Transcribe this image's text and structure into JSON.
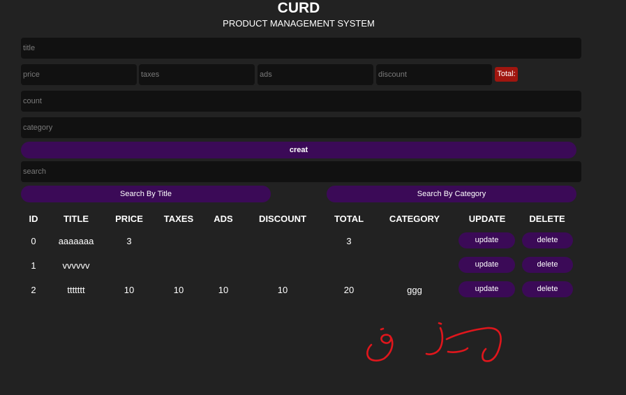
{
  "header": {
    "title": "CURD",
    "subtitle": "PRODUCT MANAGEMENT SYSTEM"
  },
  "form": {
    "title_placeholder": "title",
    "price_placeholder": "price",
    "taxes_placeholder": "taxes",
    "ads_placeholder": "ads",
    "discount_placeholder": "discount",
    "total_label": "Total:",
    "count_placeholder": "count",
    "category_placeholder": "category",
    "create_label": "creat"
  },
  "search": {
    "placeholder": "search",
    "by_title_label": "Search By Title",
    "by_category_label": "Search By Category"
  },
  "table": {
    "headers": [
      "ID",
      "TITLE",
      "PRICE",
      "TAXES",
      "ADS",
      "DISCOUNT",
      "TOTAL",
      "CATEGORY",
      "UPDATE",
      "DELETE"
    ],
    "rows": [
      {
        "id": "0",
        "title": "aaaaaaa",
        "price": "3",
        "taxes": "",
        "ads": "",
        "discount": "",
        "total": "3",
        "category": "",
        "update": "update",
        "delete": "delete"
      },
      {
        "id": "1",
        "title": "vvvvvv",
        "price": "",
        "taxes": "",
        "ads": "",
        "discount": "",
        "total": "",
        "category": "",
        "update": "update",
        "delete": "delete"
      },
      {
        "id": "2",
        "title": "ttttttt",
        "price": "10",
        "taxes": "10",
        "ads": "10",
        "discount": "10",
        "total": "20",
        "category": "ggg",
        "update": "update",
        "delete": "delete"
      }
    ]
  },
  "colors": {
    "background": "#222222",
    "input_background": "#111111",
    "button_purple": "#3b0a57",
    "total_red": "#a0160f",
    "scribble_red": "#e0161c"
  }
}
